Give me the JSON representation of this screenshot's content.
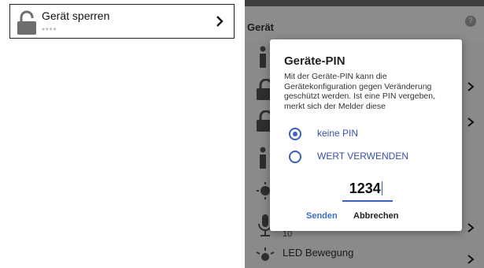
{
  "left_card": {
    "title": "Gerät sperren",
    "subtitle": "****",
    "lock_icon": "lock-open-icon",
    "chevron_icon": "chevron-right-icon"
  },
  "background_screen": {
    "header_title": "Gerät",
    "help_icon_label": "?",
    "rows": [
      {
        "icon": "info-icon"
      },
      {
        "icon": "lock-open-icon"
      },
      {
        "icon": "lock-open-icon"
      },
      {
        "icon": "info-icon"
      },
      {
        "icon": "brightness-icon"
      },
      {
        "icon": "microphone-icon",
        "value": "10"
      },
      {
        "icon": "motion-led-icon",
        "label": "LED Bewegung"
      }
    ]
  },
  "dialog": {
    "title": "Geräte-PIN",
    "message": "Mit der Geräte-PIN kann die Gerätekonfiguration gegen Veränderung geschützt werden. Ist eine PIN vergeben, merkt sich der Melder diese",
    "options": [
      {
        "label": "keine PIN",
        "selected": true
      },
      {
        "label": "WERT VERWENDEN",
        "selected": false
      }
    ],
    "pin_value": "1234",
    "send_label": "Senden",
    "cancel_label": "Abbrechen"
  },
  "colors": {
    "accent": "#3a5fbe",
    "overlay": "#8a8a8a",
    "status_bar": "#3f3f3f"
  }
}
